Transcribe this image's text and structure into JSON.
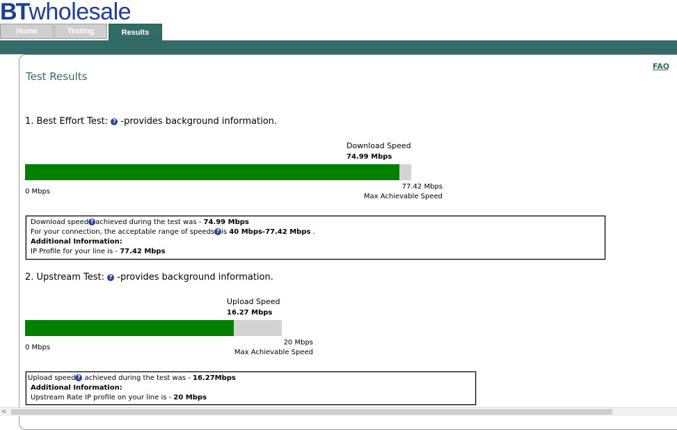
{
  "brand": {
    "bt": "BT",
    "wholesale": "wholesale"
  },
  "tabs": [
    {
      "label": "Home",
      "state": "inactive"
    },
    {
      "label": "Testing",
      "state": "inactive"
    },
    {
      "label": "Results",
      "state": "active"
    }
  ],
  "colors": {
    "brand_blue": "#1a3d9a",
    "teal": "#336b66",
    "bar_fill": "#028002",
    "bar_track": "#d3d3d3",
    "help_icon": "#2b3f9e"
  },
  "faq": "FAQ",
  "page_title": "Test Results",
  "help_glyph": "?",
  "best_effort": {
    "title_prefix": "1. Best Effort Test:",
    "title_suffix": "-provides background information.",
    "speed_label": "Download Speed",
    "speed_value": "74.99 Mbps",
    "fill_fraction": 0.9686,
    "axis_min": "0 Mbps",
    "axis_max": "77.42 Mbps",
    "axis_max_caption": "Max Achievable Speed",
    "info": {
      "line1_pre": "Download speed",
      "line1_mid": "achieved during the test was - ",
      "line1_val": "74.99 Mbps",
      "line2_pre": "For your connection, the acceptable range of speeds",
      "line2_mid": "is ",
      "line2_val": "40 Mbps-77.42 Mbps",
      "line2_post": " .",
      "line3": "Additional Information:",
      "line4_pre": "IP Profile for your line is - ",
      "line4_val": "77.42 Mbps"
    }
  },
  "upstream": {
    "title_prefix": "2. Upstream Test:",
    "title_suffix": "-provides background information.",
    "speed_label": "Upload Speed",
    "speed_value": "16.27 Mbps",
    "fill_fraction": 0.8135,
    "axis_min": "0 Mbps",
    "axis_max": "20 Mbps",
    "axis_max_caption": "Max Achievable Speed",
    "info": {
      "line1_pre": "Upload speed",
      "line1_mid": " achieved during the test was - ",
      "line1_val": "16.27Mbps",
      "line2": "Additional Information:",
      "line3_pre": "Upstream Rate IP profile on your line is - ",
      "line3_val": "20 Mbps"
    }
  },
  "scrollbar": {
    "left_arrow": "<"
  }
}
